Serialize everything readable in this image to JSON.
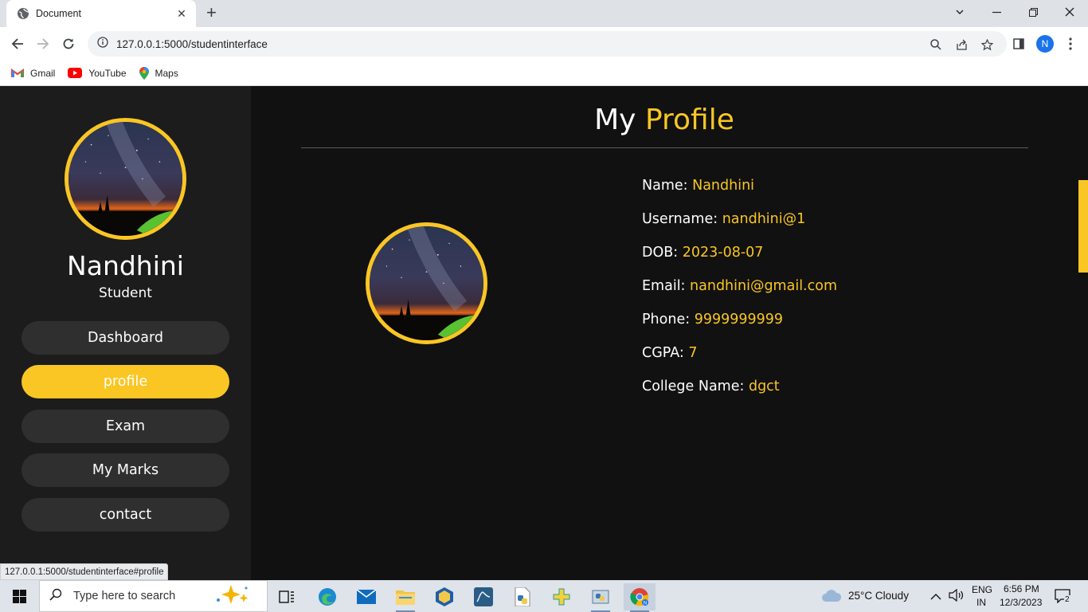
{
  "browser": {
    "tab_title": "Document",
    "url": "127.0.0.1:5000/studentinterface",
    "profile_initial": "N",
    "bookmarks": [
      {
        "label": "Gmail",
        "icon": "gmail-icon"
      },
      {
        "label": "YouTube",
        "icon": "youtube-icon"
      },
      {
        "label": "Maps",
        "icon": "maps-icon"
      }
    ],
    "status_url": "127.0.0.1:5000/studentinterface#profile"
  },
  "sidebar": {
    "name": "Nandhini",
    "role": "Student",
    "nav": [
      {
        "label": "Dashboard",
        "active": false
      },
      {
        "label": "profile",
        "active": true
      },
      {
        "label": "Exam",
        "active": false
      },
      {
        "label": "My Marks",
        "active": false
      },
      {
        "label": "contact",
        "active": false
      }
    ]
  },
  "main": {
    "title_plain": "My",
    "title_accent": "Profile",
    "fields": [
      {
        "label": "Name:",
        "value": "Nandhini"
      },
      {
        "label": "Username:",
        "value": "nandhini@1"
      },
      {
        "label": "DOB:",
        "value": "2023-08-07"
      },
      {
        "label": "Email:",
        "value": "nandhini@gmail.com"
      },
      {
        "label": "Phone:",
        "value": "9999999999"
      },
      {
        "label": "CGPA:",
        "value": "7"
      },
      {
        "label": "College Name:",
        "value": "dgct"
      }
    ]
  },
  "taskbar": {
    "search_placeholder": "Type here to search",
    "weather": "25°C  Cloudy",
    "lang_top": "ENG",
    "lang_bottom": "IN",
    "time": "6:56 PM",
    "date": "12/3/2023",
    "notifications": "2"
  },
  "colors": {
    "accent": "#f9c623",
    "sidebar_bg": "#1c1c1c",
    "main_bg": "#111111",
    "nav_bg": "#2f2f2f"
  }
}
